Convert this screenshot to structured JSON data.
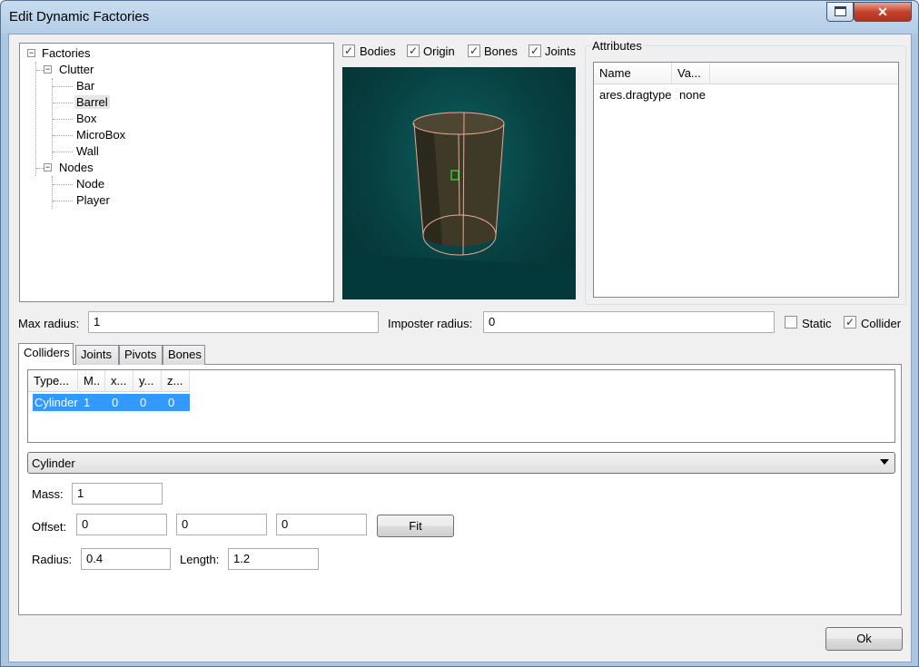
{
  "window": {
    "title": "Edit Dynamic Factories",
    "close_glyph": "✕"
  },
  "tree": {
    "root": "Factories",
    "groups": [
      {
        "label": "Clutter",
        "children": [
          "Bar",
          "Barrel",
          "Box",
          "MicroBox",
          "Wall"
        ]
      },
      {
        "label": "Nodes",
        "children": [
          "Node",
          "Player"
        ]
      }
    ],
    "selected": "Barrel",
    "expander_glyph": "−"
  },
  "view_options": [
    {
      "label": "Bodies",
      "checked": true
    },
    {
      "label": "Origin",
      "checked": true
    },
    {
      "label": "Bones",
      "checked": true
    },
    {
      "label": "Joints",
      "checked": true
    }
  ],
  "check_glyph": "✓",
  "attributes": {
    "title": "Attributes",
    "columns": [
      "Name",
      "Va..."
    ],
    "rows": [
      [
        "ares.dragtype",
        "none"
      ]
    ]
  },
  "props": {
    "max_radius_label": "Max radius:",
    "max_radius": "1",
    "imposter_radius_label": "Imposter radius:",
    "imposter_radius": "0",
    "static_label": "Static",
    "static_checked": false,
    "collider_label": "Collider",
    "collider_checked": true
  },
  "tabs": [
    "Colliders",
    "Joints",
    "Pivots",
    "Bones"
  ],
  "active_tab": "Colliders",
  "colliders": {
    "columns": [
      "Type...",
      "M..",
      "x...",
      "y...",
      "z..."
    ],
    "rows": [
      [
        "Cylinder",
        "1",
        "0",
        "0",
        "0"
      ]
    ],
    "selection_color": "#3399ff"
  },
  "collider_form": {
    "type_selected": "Cylinder",
    "mass_label": "Mass:",
    "mass": "1",
    "offset_label": "Offset:",
    "offset": [
      "0",
      "0",
      "0"
    ],
    "fit_label": "Fit",
    "radius_label": "Radius:",
    "radius": "0.4",
    "length_label": "Length:",
    "length": "1.2"
  },
  "ok_label": "Ok"
}
